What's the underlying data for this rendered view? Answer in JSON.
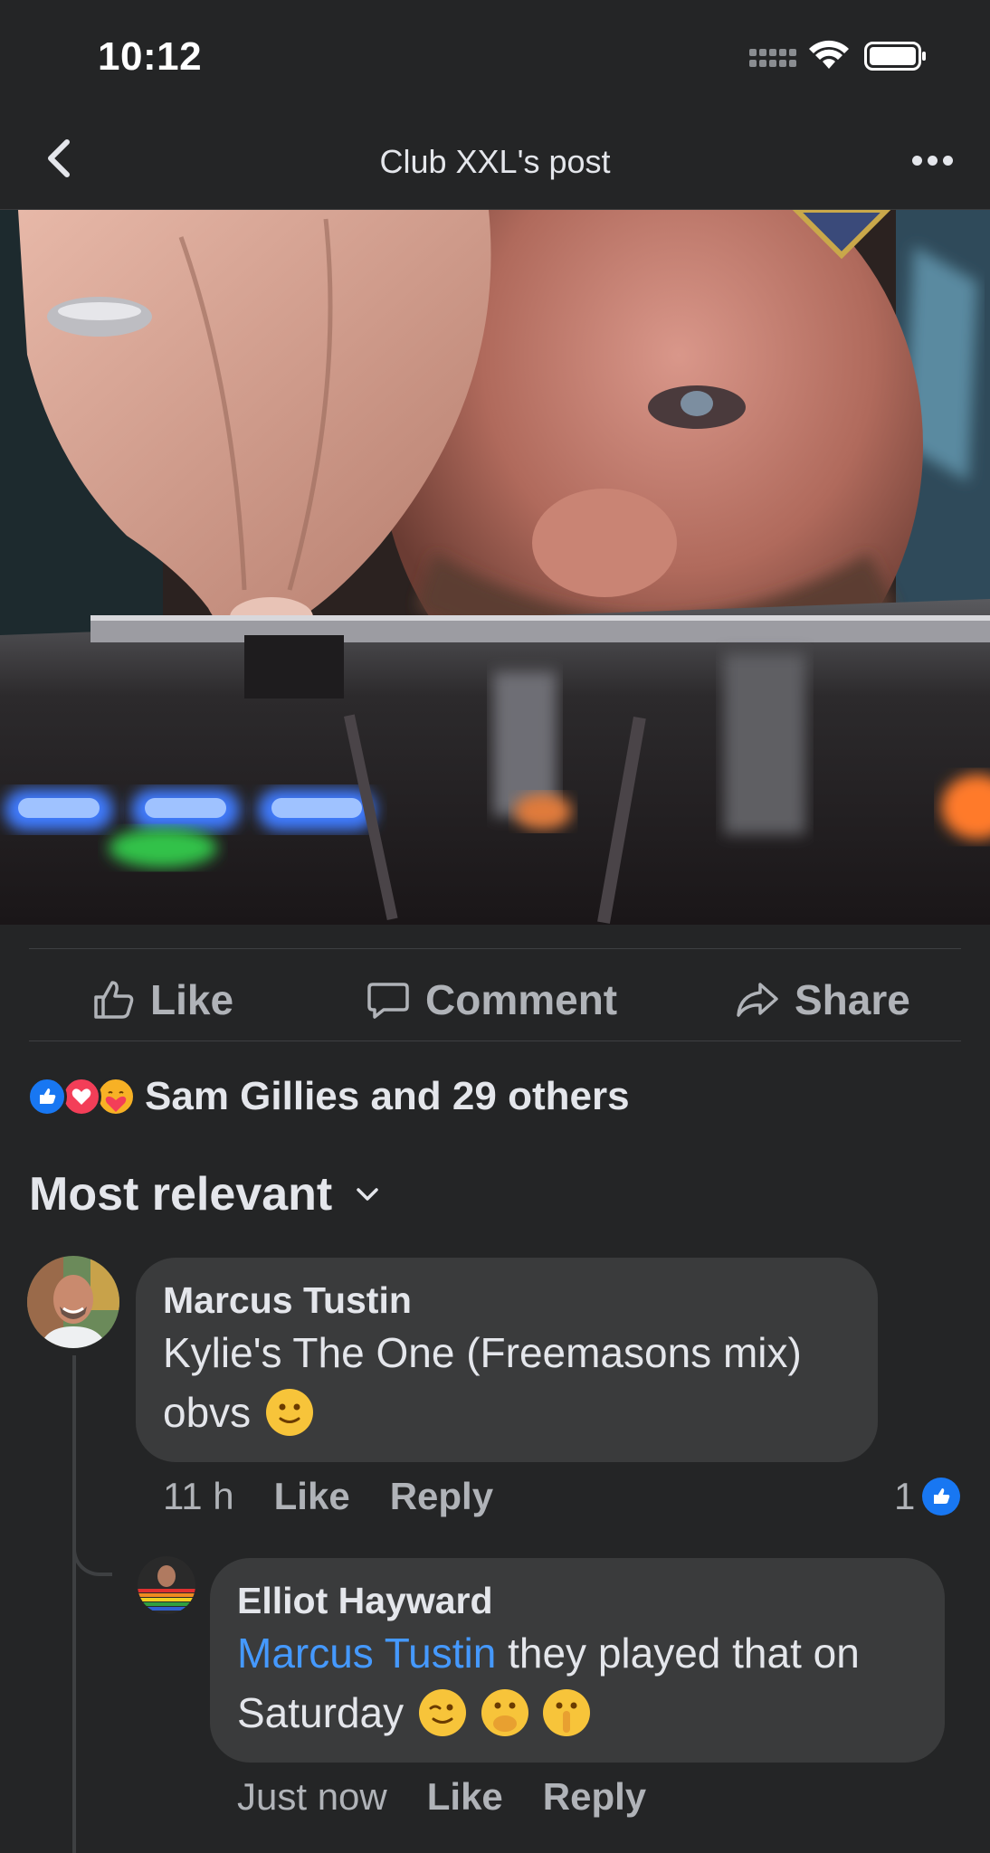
{
  "status_bar": {
    "time": "10:12"
  },
  "nav": {
    "title": "Club XXL's post"
  },
  "actions": {
    "like": "Like",
    "comment": "Comment",
    "share": "Share"
  },
  "reactions": {
    "summary": "Sam Gillies and 29 others"
  },
  "sort": {
    "label": "Most relevant"
  },
  "comments": [
    {
      "author": "Marcus Tustin",
      "text": "Kylie's The One (Freemasons mix) obvs",
      "time": "11 h",
      "like": "Like",
      "reply": "Reply",
      "like_count": "1"
    },
    {
      "author": "Elliot Hayward",
      "mention": "Marcus Tustin",
      "text_line1": " they played that on",
      "text_line2": "Saturday",
      "time": "Just now",
      "like": "Like",
      "reply": "Reply"
    }
  ],
  "colors": {
    "background": "#242526",
    "bubble": "#3a3b3c",
    "mention": "#4599ff",
    "like_blue": "#1877f2",
    "love_red": "#f33e58"
  }
}
